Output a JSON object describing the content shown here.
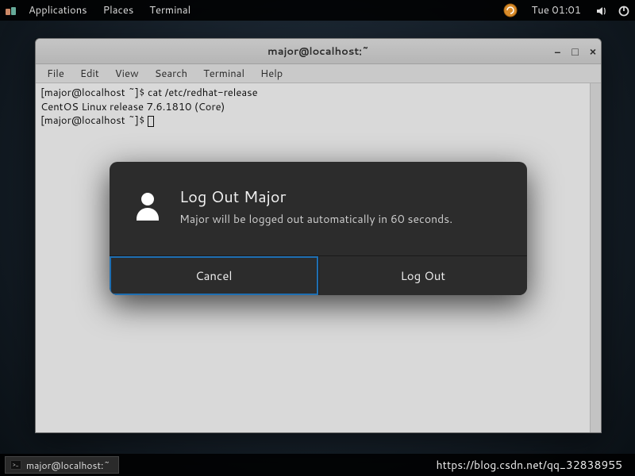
{
  "top_panel": {
    "applications": "Applications",
    "places": "Places",
    "terminal": "Terminal",
    "clock": "Tue 01:01"
  },
  "terminal": {
    "title": "major@localhost:~",
    "menus": {
      "file": "File",
      "edit": "Edit",
      "view": "View",
      "search": "Search",
      "terminal": "Terminal",
      "help": "Help"
    },
    "line1": "[major@localhost ~]$ cat /etc/redhat-release",
    "line2": "CentOS Linux release 7.6.1810 (Core)",
    "line3": "[major@localhost ~]$ "
  },
  "dialog": {
    "title": "Log Out Major",
    "message": "Major will be logged out automatically in 60 seconds.",
    "cancel": "Cancel",
    "logout": "Log Out"
  },
  "bottom_panel": {
    "task": "major@localhost:~",
    "watermark": "https://blog.csdn.net/qq_32838955"
  }
}
